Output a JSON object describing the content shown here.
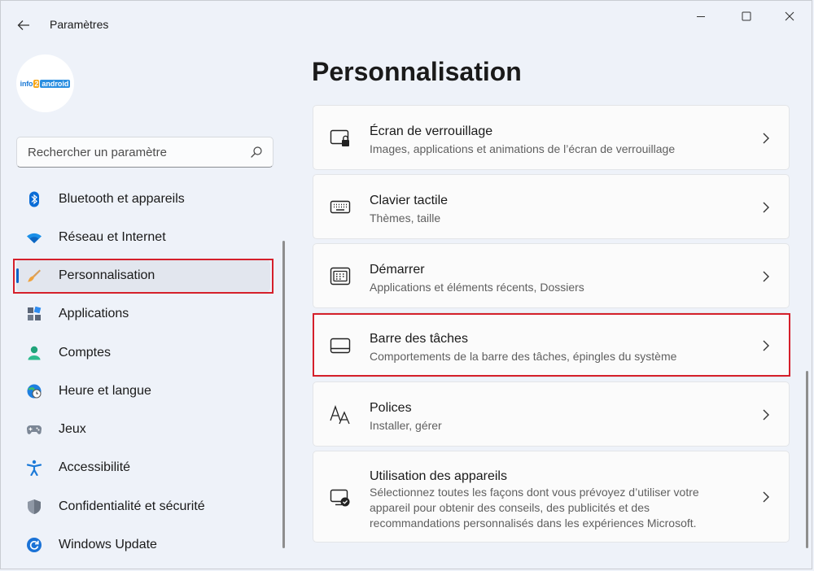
{
  "window": {
    "title": "Paramètres"
  },
  "profile": {
    "logo_parts": [
      "info",
      "2",
      "android"
    ]
  },
  "search": {
    "placeholder": "Rechercher un paramètre"
  },
  "sidebar": {
    "items": [
      {
        "label": "Bluetooth et appareils",
        "icon": "bluetooth-icon"
      },
      {
        "label": "Réseau et Internet",
        "icon": "wifi-icon"
      },
      {
        "label": "Personnalisation",
        "icon": "paintbrush-icon",
        "active": true
      },
      {
        "label": "Applications",
        "icon": "apps-icon"
      },
      {
        "label": "Comptes",
        "icon": "person-icon"
      },
      {
        "label": "Heure et langue",
        "icon": "globe-clock-icon"
      },
      {
        "label": "Jeux",
        "icon": "gamepad-icon"
      },
      {
        "label": "Accessibilité",
        "icon": "accessibility-icon"
      },
      {
        "label": "Confidentialité et sécurité",
        "icon": "shield-icon"
      },
      {
        "label": "Windows Update",
        "icon": "refresh-icon"
      }
    ]
  },
  "main": {
    "title": "Personnalisation",
    "cards": [
      {
        "title": "Écran de verrouillage",
        "subtitle": "Images, applications et animations de l’écran de verrouillage",
        "icon": "lock-screen-icon"
      },
      {
        "title": "Clavier tactile",
        "subtitle": "Thèmes, taille",
        "icon": "keyboard-icon"
      },
      {
        "title": "Démarrer",
        "subtitle": "Applications et éléments récents, Dossiers",
        "icon": "start-menu-icon"
      },
      {
        "title": "Barre des tâches",
        "subtitle": "Comportements de la barre des tâches, épingles du système",
        "icon": "taskbar-icon"
      },
      {
        "title": "Polices",
        "subtitle": "Installer, gérer",
        "icon": "fonts-icon"
      },
      {
        "title": "Utilisation des appareils",
        "subtitle_lines": [
          "Sélectionnez toutes les façons dont vous prévoyez d’utiliser votre",
          "appareil pour obtenir des conseils, des publicités et des",
          "recommandations personnalisés dans les expériences Microsoft."
        ],
        "icon": "device-usage-icon"
      }
    ]
  },
  "colors": {
    "accent": "#0a63c8",
    "highlight_border": "#d5202b",
    "background": "#eef2f9",
    "card": "#fbfbfb"
  }
}
